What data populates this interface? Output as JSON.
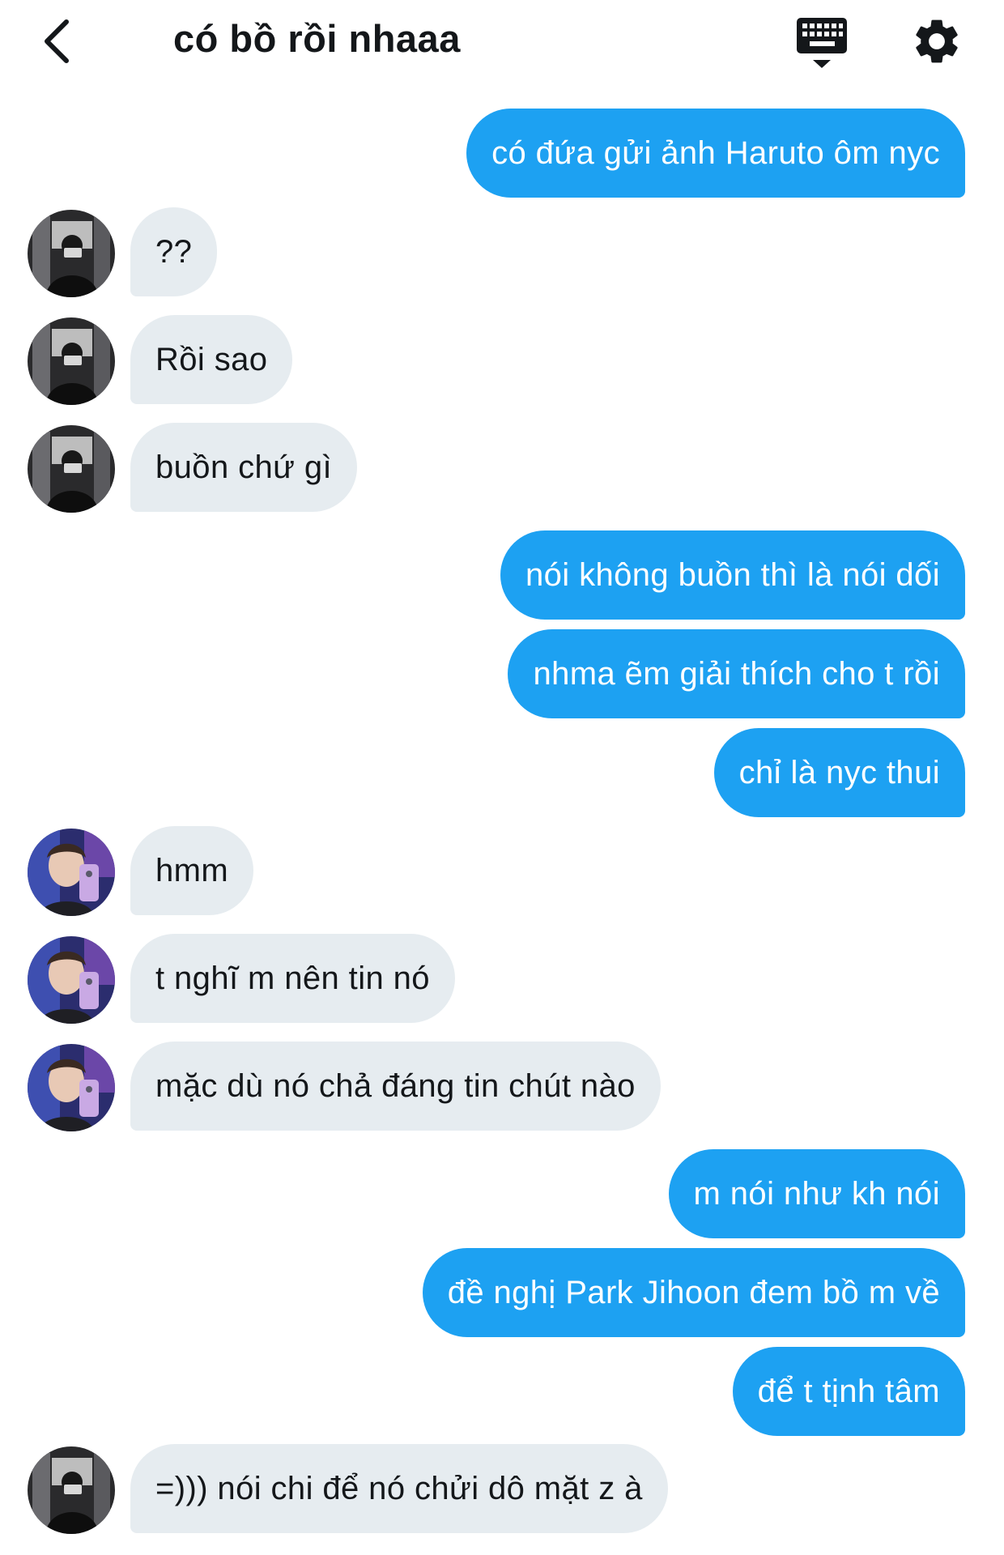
{
  "header": {
    "title": "có bồ rồi nhaaa",
    "back_icon": "chevron-left-icon",
    "keyboard_icon": "keyboard-hide-icon",
    "settings_icon": "gear-icon"
  },
  "colors": {
    "outgoing_bubble": "#1da1f2",
    "incoming_bubble": "#e6ecf0",
    "text": "#14171a"
  },
  "messages": [
    {
      "side": "out",
      "text": "có đứa gửi ảnh Haruto ôm nyc"
    },
    {
      "side": "in",
      "sender": "friend-a",
      "text": "??"
    },
    {
      "side": "in",
      "sender": "friend-a",
      "text": "Rồi sao"
    },
    {
      "side": "in",
      "sender": "friend-a",
      "text": "buồn chứ gì"
    },
    {
      "side": "out",
      "text": "nói không buồn thì là nói dối"
    },
    {
      "side": "out",
      "text": "nhma ẽm giải thích cho t rồi"
    },
    {
      "side": "out",
      "text": "chỉ là nyc thui"
    },
    {
      "side": "in",
      "sender": "friend-b",
      "text": "hmm"
    },
    {
      "side": "in",
      "sender": "friend-b",
      "text": "t nghĩ m nên tin nó"
    },
    {
      "side": "in",
      "sender": "friend-b",
      "text": "mặc dù nó chả đáng tin chút nào"
    },
    {
      "side": "out",
      "text": "m nói như kh nói"
    },
    {
      "side": "out",
      "text": "đề nghị Park Jihoon đem bồ m về"
    },
    {
      "side": "out",
      "text": "để t tịnh tâm"
    },
    {
      "side": "in",
      "sender": "friend-a",
      "text": "=))) nói chi để nó chửi dô mặt z à"
    }
  ]
}
